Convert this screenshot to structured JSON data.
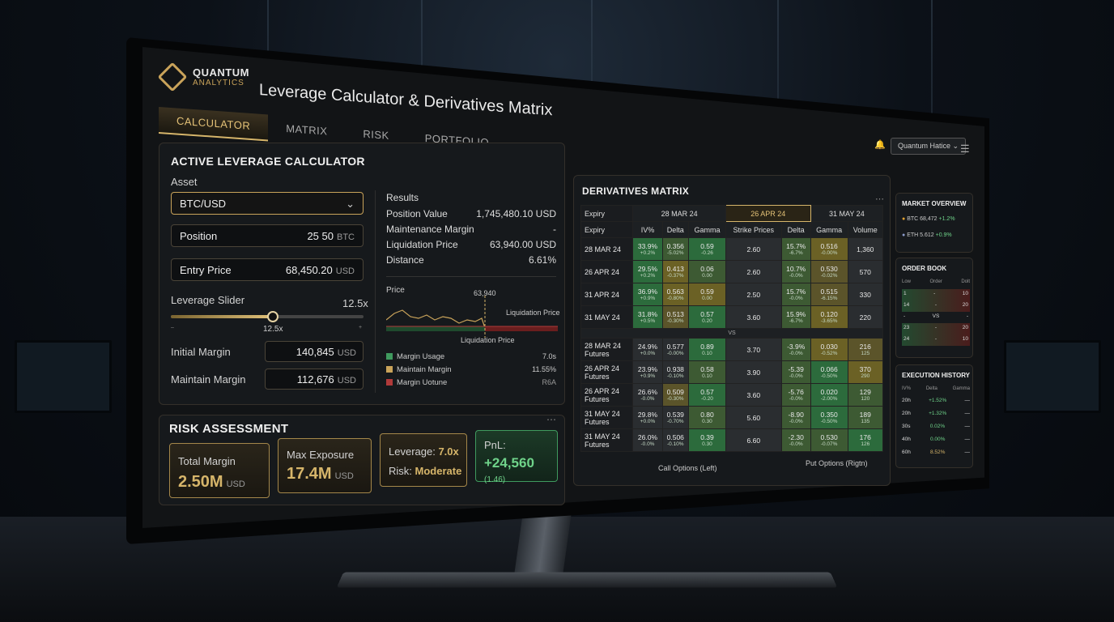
{
  "app": {
    "brand_line1": "QUANTUM",
    "brand_line2": "ANALYTICS",
    "title": "Leverage Calculator & Derivatives Matrix"
  },
  "tabs": [
    {
      "label": "CALCULATOR"
    },
    {
      "label": "MATRIX"
    },
    {
      "label": "RISK"
    },
    {
      "label": "PORTFOLIO"
    }
  ],
  "user": {
    "name": "Quantum Hatice"
  },
  "calculator": {
    "title": "ACTIVE LEVERAGE CALCULATOR",
    "asset_label": "Asset",
    "asset_value": "BTC/USD",
    "position_label": "Position",
    "position_value": "25 50",
    "position_unit": "BTC",
    "entry_label": "Entry Price",
    "entry_value": "68,450.20",
    "entry_unit": "USD",
    "slider_label": "Leverage Slider",
    "slider_value": "12.5x",
    "slider_min": "–",
    "slider_max": "+",
    "slider_fraction": 0.53,
    "initial_margin_label": "Initial Margin",
    "initial_margin_value": "140,845",
    "initial_margin_unit": "USD",
    "maintain_margin_label": "Maintain Margin",
    "maintain_margin_value": "112,676",
    "maintain_margin_unit": "USD",
    "results_title": "Results",
    "results": [
      {
        "label": "Position Value",
        "value": "1,745,480.10 USD"
      },
      {
        "label": "Maintenance Margin",
        "value": "-"
      },
      {
        "label": "Liquidation Price",
        "value": "63,940.00 USD"
      },
      {
        "label": "Distance",
        "value": "6.61%"
      }
    ],
    "chart": {
      "y_label": "Price",
      "marker_value": "63,940",
      "line_label": "Liquidation Price",
      "bottom_label": "Liquidation Price"
    },
    "legend": [
      {
        "label": "Margin Usage",
        "value": "7.0s",
        "color": "#3f9a5e"
      },
      {
        "label": "Maintain Margin",
        "value": "11.55%",
        "color": "#c9a35a"
      },
      {
        "label": "Margin Uotune",
        "value": "R6A",
        "color": "#b03a3a"
      }
    ]
  },
  "risk": {
    "title": "RISK ASSESSMENT",
    "total_margin_label": "Total Margin",
    "total_margin_value": "2.50M",
    "total_margin_unit": "USD",
    "max_exposure_label": "Max Exposure",
    "max_exposure_value": "17.4M",
    "max_exposure_unit": "USD",
    "leverage_label": "Leverage:",
    "leverage_value": "7.0x",
    "risk_label": "Risk:",
    "risk_value": "Moderate",
    "pnl_label": "PnL:",
    "pnl_value": "+24,560",
    "pnl_sub": "(1.46)"
  },
  "derivatives": {
    "title": "DERIVATIVES MATRIX",
    "more": "...",
    "expiry_header": "Expiry",
    "expiries": [
      "28 MAR 24",
      "26 APR 24",
      "31 MAY 24"
    ],
    "columns": [
      "Expiry",
      "IV%",
      "Delta",
      "Gamma",
      "Strike Prices",
      "Delta",
      "Gamma",
      "Volume"
    ],
    "vs": "VS",
    "rows_top": [
      {
        "exp": "28 MAR 24",
        "iv": "33.9%",
        "iv_s": "+0.2%",
        "d": "0.356",
        "d_s": "-5.02%",
        "g": "0.59",
        "g_s": "-0.26",
        "k": "2.60",
        "pd": "15.7%",
        "pd_s": "-6.7%",
        "pg": "0.516",
        "pg_s": "-0.00%",
        "vol": "1,360"
      },
      {
        "exp": "26 APR 24",
        "iv": "29.5%",
        "iv_s": "+0.2%",
        "d": "0.413",
        "d_s": "-0.37%",
        "g": "0.06",
        "g_s": "0.00",
        "k": "2.60",
        "pd": "10.7%",
        "pd_s": "-0.0%",
        "pg": "0.530",
        "pg_s": "-0.02%",
        "vol": "570"
      },
      {
        "exp": "31 APR 24",
        "iv": "36.9%",
        "iv_s": "+0.9%",
        "d": "0.563",
        "d_s": "-0.80%",
        "g": "0.59",
        "g_s": "0.00",
        "k": "2.50",
        "pd": "15.7%",
        "pd_s": "-0.0%",
        "pg": "0.515",
        "pg_s": "-6.15%",
        "vol": "330"
      },
      {
        "exp": "31 MAY 24",
        "iv": "31.8%",
        "iv_s": "+0.5%",
        "d": "0.513",
        "d_s": "-0.30%",
        "g": "0.57",
        "g_s": "0.20",
        "k": "3.60",
        "pd": "15.9%",
        "pd_s": "-6.7%",
        "pg": "0.120",
        "pg_s": "-3.65%",
        "vol": "220"
      }
    ],
    "rows_bottom": [
      {
        "exp": "28 MAR 24",
        "exp2": "Futures",
        "iv": "24.9%",
        "iv_s": "+0.0%",
        "d": "0.577",
        "d_s": "-0.00%",
        "g": "0.89",
        "g_s": "0.10",
        "k": "3.70",
        "pd": "-3.9%",
        "pd_s": "-0.0%",
        "pg": "0.030",
        "pg_s": "-0.52%",
        "vol": "216",
        "vol_s": "125"
      },
      {
        "exp": "26 APR 24",
        "exp2": "Futures",
        "iv": "23.9%",
        "iv_s": "+0.9%",
        "d": "0.938",
        "d_s": "-0.10%",
        "g": "0.58",
        "g_s": "0.10",
        "k": "3.90",
        "pd": "-5.39",
        "pd_s": "-0.0%",
        "pg": "0.066",
        "pg_s": "-0.50%",
        "vol": "370",
        "vol_s": "290"
      },
      {
        "exp": "26 APR 24",
        "exp2": "Futures",
        "iv": "26.6%",
        "iv_s": "-0.0%",
        "d": "0.509",
        "d_s": "-0.30%",
        "g": "0.57",
        "g_s": "-0.20",
        "k": "3.60",
        "pd": "-5.76",
        "pd_s": "-0.0%",
        "pg": "0.020",
        "pg_s": "-2.00%",
        "vol": "129",
        "vol_s": "120"
      },
      {
        "exp": "31 MAY 24",
        "exp2": "Futures",
        "iv": "29.8%",
        "iv_s": "+0.0%",
        "d": "0.539",
        "d_s": "-0.70%",
        "g": "0.80",
        "g_s": "0.30",
        "k": "5.60",
        "pd": "-8.90",
        "pd_s": "-0.0%",
        "pg": "0.350",
        "pg_s": "-0.50%",
        "vol": "189",
        "vol_s": "135"
      },
      {
        "exp": "31 MAY 24",
        "exp2": "Futures",
        "iv": "26.0%",
        "iv_s": "-0.0%",
        "d": "0.506",
        "d_s": "-0.10%",
        "g": "0.39",
        "g_s": "0.30",
        "k": "6.60",
        "pd": "-2.30",
        "pd_s": "-0.0%",
        "pg": "0.530",
        "pg_s": "-0.07%",
        "vol": "176",
        "vol_s": "126"
      }
    ],
    "foot_left": "Call Options (Left)",
    "foot_right": "Put Options (Rigtn)"
  },
  "market": {
    "title": "MARKET OVERVIEW",
    "btc": "BTC 68,472",
    "btc_chg": "+1.2%",
    "eth": "ETH 5.612",
    "eth_chg": "+0.9%"
  },
  "orderbook": {
    "title": "ORDER BOOK",
    "cols": [
      "Low",
      "Order",
      "Dolt"
    ],
    "rows": [
      [
        "1",
        "-",
        "10"
      ],
      [
        "14",
        "-",
        "20"
      ],
      [
        "-",
        "VS",
        "-"
      ],
      [
        "23",
        "-",
        "20"
      ],
      [
        "24",
        "-",
        "10"
      ]
    ]
  },
  "history": {
    "title": "EXECUTION HISTORY",
    "cols": [
      "IV%",
      "Delta",
      "Gamma"
    ],
    "rows": [
      [
        "20h",
        "+1.52%",
        "—"
      ],
      [
        "20h",
        "+1.32%",
        "—"
      ],
      [
        "30s",
        "0.02%",
        "—"
      ],
      [
        "40h",
        "0.00%",
        "—"
      ],
      [
        "60h",
        "8.52%",
        "—"
      ]
    ]
  }
}
